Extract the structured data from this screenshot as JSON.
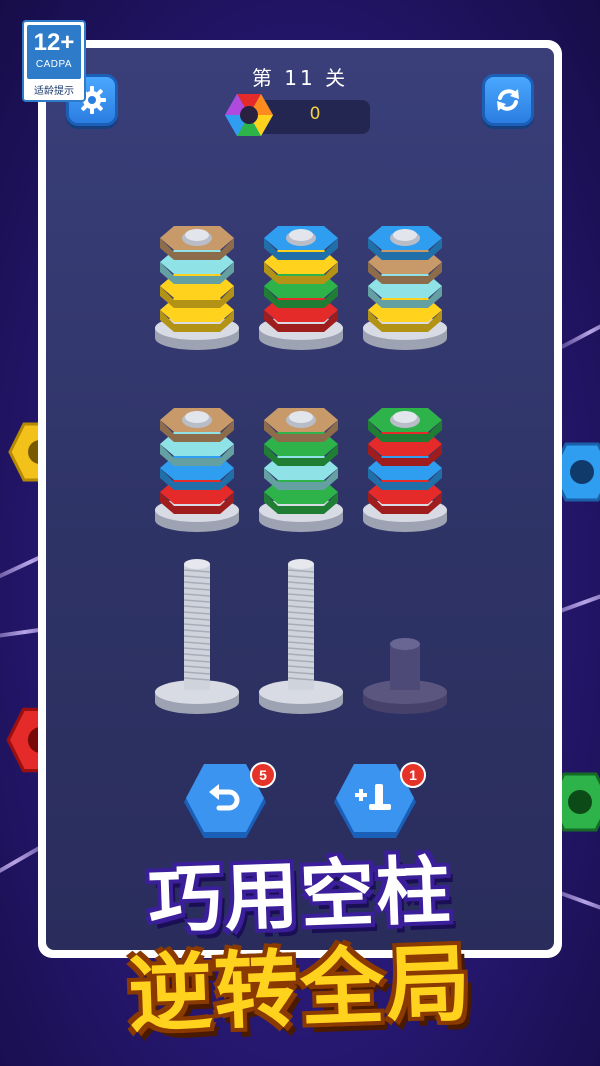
{
  "age_rating": {
    "number": "12+",
    "org": "CADPA",
    "tip": "适龄提示"
  },
  "header": {
    "level_title": "第 11 关",
    "score": "0"
  },
  "actions": {
    "undo_count": "5",
    "add_peg_count": "1"
  },
  "slogan": {
    "line1": "巧用空柱",
    "line2": "逆转全局"
  },
  "colors": {
    "brown": "#c89a6a",
    "cyan": "#8fe3e6",
    "yellow": "#ffd21e",
    "blue": "#2f9ef0",
    "green": "#2db34a",
    "red": "#e52a2a",
    "accent_blue": "#2b7de0",
    "screen_bg": "#333770"
  },
  "pegs": [
    {
      "nuts": [
        "brown",
        "cyan",
        "yellow",
        "yellow"
      ]
    },
    {
      "nuts": [
        "blue",
        "yellow",
        "green",
        "red"
      ]
    },
    {
      "nuts": [
        "blue",
        "brown",
        "cyan",
        "yellow"
      ]
    },
    {
      "nuts": [
        "brown",
        "cyan",
        "blue",
        "red"
      ]
    },
    {
      "nuts": [
        "brown",
        "green",
        "cyan",
        "green"
      ]
    },
    {
      "nuts": [
        "green",
        "red",
        "blue",
        "red"
      ]
    },
    {
      "nuts": [],
      "type": "empty"
    },
    {
      "nuts": [],
      "type": "empty"
    },
    {
      "nuts": [],
      "type": "locked"
    }
  ]
}
